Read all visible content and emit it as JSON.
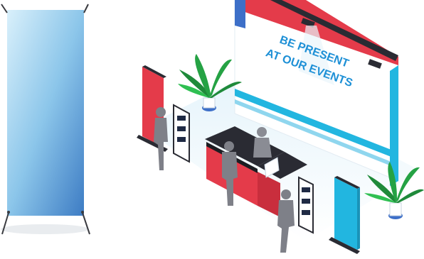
{
  "scene": {
    "headline_line1": "BE PRESENT",
    "headline_line2": "AT OUR EVENTS"
  },
  "colors": {
    "background": "#ffffff",
    "banner_blue_light": "#cfe9f7",
    "banner_blue_dark": "#3d7cc4",
    "booth_red": "#e43b4a",
    "booth_dark": "#2a2b33",
    "accent_cyan": "#22b6e0",
    "plant_green": "#25a244",
    "headline_text": "#1e90d6",
    "silhouette": "#7e8088"
  },
  "icons": {
    "banner_stand": "x-banner-stand-icon",
    "booth": "exhibition-booth-icon",
    "plant": "potted-palm-icon",
    "person": "person-silhouette-icon"
  }
}
